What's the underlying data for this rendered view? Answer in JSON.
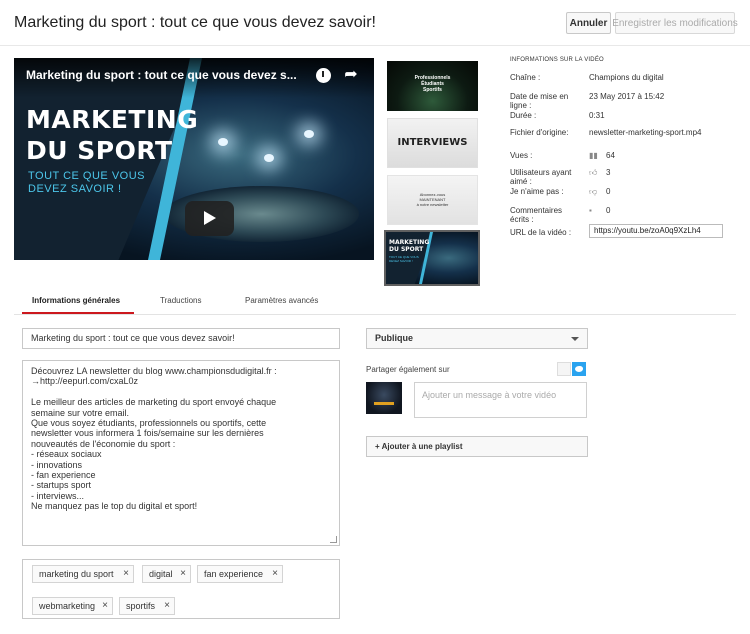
{
  "header": {
    "title": "Marketing du sport : tout ce que vous devez savoir!",
    "cancel_label": "Annuler",
    "save_label": "Enregistrer les modifications"
  },
  "player": {
    "overlay_title": "Marketing du sport : tout ce que vous devez s...",
    "headline_line1": "MARKETING",
    "headline_line2": "DU SPORT",
    "subline_line1": "TOUT CE QUE VOUS",
    "subline_line2": "DEVEZ SAVOIR !"
  },
  "thumbnails": {
    "t1_line1": "Professionnels",
    "t1_line2": "Étudiants",
    "t1_line3": "Sportifs",
    "t2_text": "INTERVIEWS",
    "t3_line1": "Abonnez-vous",
    "t3_line2": "MAINTENANT",
    "t3_line3": "à notre newsletter",
    "t4_line1": "MARKETING",
    "t4_line2": "DU SPORT",
    "t4_sub1": "TOUT CE QUE VOUS",
    "t4_sub2": "DEVEZ SAVOIR !"
  },
  "info": {
    "heading": "INFORMATIONS SUR LA VIDÉO",
    "channel_label": "Chaîne :",
    "channel_value": "Champions du digital",
    "date_label": "Date de mise en ligne :",
    "date_value": "23 May 2017 à 15:42",
    "duration_label": "Durée :",
    "duration_value": "0:31",
    "file_label": "Fichier d'origine:",
    "file_value": "newsletter-marketing-sport.mp4",
    "views_label": "Vues :",
    "views_value": "64",
    "likes_label": "Utilisateurs ayant aimé :",
    "likes_value": "3",
    "dislikes_label": "Je n'aime pas :",
    "dislikes_value": "0",
    "comments_label": "Commentaires écrits :",
    "comments_value": "0",
    "url_label": "URL de la vidéo :",
    "url_value": "https://youtu.be/zoA0q9XzLh4"
  },
  "tabs": {
    "general": "Informations générales",
    "translations": "Traductions",
    "advanced": "Paramètres avancés"
  },
  "form": {
    "title_value": "Marketing du sport : tout ce que vous devez savoir!",
    "description_lines": [
      "Découvrez LA newsletter du blog www.championsdudigital.fr :",
      "→http://eepurl.com/cxaL0z",
      "",
      "Le meilleur des articles de marketing du sport envoyé chaque",
      "semaine sur votre email.",
      "Que vous soyez étudiants, professionnels ou sportifs, cette",
      "newsletter vous informera 1 fois/semaine sur les dernières",
      "nouveautés de l'économie du sport :",
      "- réseaux sociaux",
      "- innovations",
      "- fan experience",
      "- startups sport",
      "- interviews...",
      "Ne manquez pas le top du digital et sport!"
    ],
    "tags": [
      "marketing du sport",
      "digital",
      "fan experience",
      "webmarketing",
      "sportifs"
    ],
    "privacy_value": "Publique",
    "share_label": "Partager également sur",
    "message_placeholder": "Ajouter un message à votre vidéo",
    "playlist_label": "+ Ajouter à une playlist"
  }
}
